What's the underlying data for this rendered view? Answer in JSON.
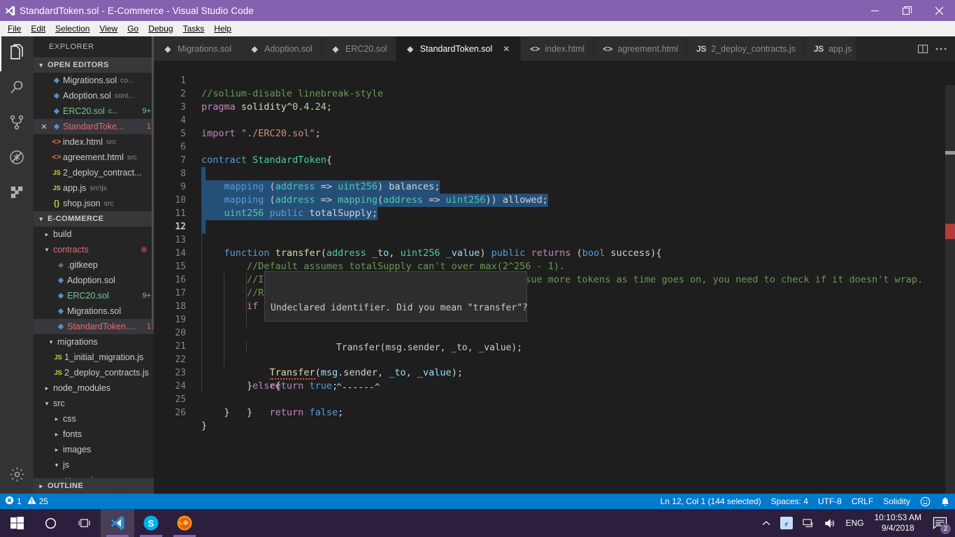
{
  "window": {
    "title": "StandardToken.sol - E-Commerce - Visual Studio Code",
    "icon": "vscode-logo-icon",
    "minimize": "minimize-icon",
    "maximize": "restore-icon",
    "close": "close-icon",
    "accent_color": "#8661b0"
  },
  "menu": {
    "items": [
      {
        "label": "File"
      },
      {
        "label": "Edit"
      },
      {
        "label": "Selection"
      },
      {
        "label": "View"
      },
      {
        "label": "Go"
      },
      {
        "label": "Debug"
      },
      {
        "label": "Tasks"
      },
      {
        "label": "Help"
      }
    ]
  },
  "activity_bar": {
    "items": [
      {
        "name": "explorer",
        "icon": "files-icon",
        "active": true
      },
      {
        "name": "search",
        "icon": "search-icon",
        "active": false
      },
      {
        "name": "source-control",
        "icon": "source-control-icon",
        "active": false
      },
      {
        "name": "debug",
        "icon": "debug-icon",
        "active": false
      },
      {
        "name": "extensions",
        "icon": "extensions-icon",
        "active": false
      }
    ],
    "bottom": [
      {
        "name": "manage",
        "icon": "gear-icon"
      }
    ]
  },
  "sidebar": {
    "title": "EXPLORER",
    "open_editors": {
      "label": "OPEN EDITORS",
      "items": [
        {
          "name": "Migrations.sol",
          "desc": "co...",
          "icon": "solidity-icon",
          "state": "normal",
          "badge": ""
        },
        {
          "name": "Adoption.sol",
          "desc": "cont...",
          "icon": "solidity-icon",
          "state": "normal",
          "badge": ""
        },
        {
          "name": "ERC20.sol",
          "desc": "c...",
          "icon": "solidity-icon",
          "state": "modified",
          "badge": "9+"
        },
        {
          "name": "StandardToke...",
          "desc": "",
          "icon": "solidity-icon",
          "state": "error",
          "badge": "1",
          "selected": true,
          "close": "✕"
        },
        {
          "name": "index.html",
          "desc": "src",
          "icon": "html-icon",
          "state": "normal",
          "badge": ""
        },
        {
          "name": "agreement.html",
          "desc": "src",
          "icon": "html-icon",
          "state": "normal",
          "badge": ""
        },
        {
          "name": "2_deploy_contract...",
          "desc": "",
          "icon": "js-icon",
          "state": "normal",
          "badge": ""
        },
        {
          "name": "app.js",
          "desc": "src\\js",
          "icon": "js-icon",
          "state": "normal",
          "badge": ""
        },
        {
          "name": "shop.json",
          "desc": "src",
          "icon": "json-icon",
          "state": "normal",
          "badge": ""
        }
      ]
    },
    "project": {
      "label": "E-COMMERCE",
      "items": [
        {
          "name": "build",
          "kind": "folder",
          "expanded": false,
          "indent": 1,
          "state": "normal",
          "badge": ""
        },
        {
          "name": "contracts",
          "kind": "folder",
          "expanded": true,
          "indent": 1,
          "state": "error",
          "badge": "",
          "dot": true
        },
        {
          "name": ".gitkeep",
          "kind": "file",
          "icon": "gitkeep-icon",
          "indent": 2,
          "state": "normal",
          "badge": ""
        },
        {
          "name": "Adoption.sol",
          "kind": "file",
          "icon": "solidity-icon",
          "indent": 2,
          "state": "normal",
          "badge": ""
        },
        {
          "name": "ERC20.sol",
          "kind": "file",
          "icon": "solidity-icon",
          "indent": 2,
          "state": "modified",
          "badge": "9+"
        },
        {
          "name": "Migrations.sol",
          "kind": "file",
          "icon": "solidity-icon",
          "indent": 2,
          "state": "normal",
          "badge": ""
        },
        {
          "name": "StandardToken....",
          "kind": "file",
          "icon": "solidity-icon",
          "indent": 2,
          "state": "error",
          "badge": "1",
          "selected": true
        },
        {
          "name": "migrations",
          "kind": "folder",
          "expanded": true,
          "indent": 1,
          "state": "normal",
          "badge": ""
        },
        {
          "name": "1_initial_migration.js",
          "kind": "file",
          "icon": "js-icon",
          "indent": 2,
          "state": "normal",
          "badge": ""
        },
        {
          "name": "2_deploy_contracts.js",
          "kind": "file",
          "icon": "js-icon",
          "indent": 2,
          "state": "normal",
          "badge": ""
        },
        {
          "name": "node_modules",
          "kind": "folder",
          "expanded": false,
          "indent": 1,
          "state": "normal",
          "badge": ""
        },
        {
          "name": "src",
          "kind": "folder",
          "expanded": true,
          "indent": 1,
          "state": "normal",
          "badge": ""
        },
        {
          "name": "css",
          "kind": "folder",
          "expanded": false,
          "indent": 2,
          "state": "normal",
          "badge": ""
        },
        {
          "name": "fonts",
          "kind": "folder",
          "expanded": false,
          "indent": 2,
          "state": "normal",
          "badge": ""
        },
        {
          "name": "images",
          "kind": "folder",
          "expanded": false,
          "indent": 2,
          "state": "normal",
          "badge": ""
        },
        {
          "name": "js",
          "kind": "folder",
          "expanded": true,
          "indent": 2,
          "state": "normal",
          "badge": ""
        },
        {
          "name": "app.js",
          "kind": "file",
          "icon": "js-icon",
          "indent": 3,
          "state": "normal",
          "badge": ""
        }
      ]
    },
    "outline_label": "OUTLINE"
  },
  "tabs": {
    "items": [
      {
        "label": "Migrations.sol",
        "icon": "solidity-icon",
        "active": false
      },
      {
        "label": "Adoption.sol",
        "icon": "solidity-icon",
        "active": false
      },
      {
        "label": "ERC20.sol",
        "icon": "solidity-icon",
        "active": false
      },
      {
        "label": "StandardToken.sol",
        "icon": "solidity-icon",
        "active": true,
        "close": "✕"
      },
      {
        "label": "index.html",
        "icon": "html-icon",
        "active": false
      },
      {
        "label": "agreement.html",
        "icon": "html-icon",
        "active": false
      },
      {
        "label": "2_deploy_contracts.js",
        "icon": "js-icon",
        "active": false
      },
      {
        "label": "app.js",
        "icon": "js-icon",
        "active": false
      }
    ],
    "actions": [
      {
        "name": "split-editor-icon"
      },
      {
        "name": "more-actions-icon"
      }
    ]
  },
  "editor": {
    "lines": [
      {
        "n": "1",
        "text": "//solium-disable linebreak-style"
      },
      {
        "n": "2",
        "text": "pragma solidity^0.4.24;"
      },
      {
        "n": "3",
        "text": ""
      },
      {
        "n": "4",
        "text": "import \"./ERC20.sol\";"
      },
      {
        "n": "5",
        "text": ""
      },
      {
        "n": "6",
        "text": "contract StandardToken{"
      },
      {
        "n": "7",
        "text": ""
      },
      {
        "n": "8",
        "text": "    mapping (address => uint256) balances;"
      },
      {
        "n": "9",
        "text": "    mapping (address => mapping(address => uint256)) allowed;"
      },
      {
        "n": "10",
        "text": "    uint256 public totalSupply;"
      },
      {
        "n": "11",
        "text": ""
      },
      {
        "n": "12",
        "text": "    function transfer(address _to, uint256 _value) public returns (bool success){"
      },
      {
        "n": "13",
        "text": "        //Default assumes totalSupply can't over max(2^256 - 1)."
      },
      {
        "n": "14",
        "text": "        //If your token leaves out totalSupply and can issue more tokens as time goes on, you need to check if it doesn't wrap."
      },
      {
        "n": "15",
        "text": "        //Replace the if with this one instead."
      },
      {
        "n": "16",
        "text": "        if ("
      },
      {
        "n": "17",
        "text": ""
      },
      {
        "n": "18",
        "text": ""
      },
      {
        "n": "19",
        "text": "            Transfer(msg.sender, _to, _value);"
      },
      {
        "n": "20",
        "text": "            return true;"
      },
      {
        "n": "21",
        "text": "        }else{"
      },
      {
        "n": "22",
        "text": "            return false;"
      },
      {
        "n": "23",
        "text": "        }"
      },
      {
        "n": "24",
        "text": "    }"
      },
      {
        "n": "25",
        "text": ""
      },
      {
        "n": "26",
        "text": "}"
      }
    ],
    "current_line": "12",
    "hover_tooltip": {
      "line1": "Undeclared identifier. Did you mean \"transfer\"?",
      "line2": "            Transfer(msg.sender, _to, _value);",
      "line3": "            ^------^"
    },
    "error_marker_color": "#b43c3c",
    "selection_color": "#264f78"
  },
  "status_bar": {
    "errors_icon": "error-circle-icon",
    "errors": "1",
    "warnings_icon": "warning-triangle-icon",
    "warnings": "25",
    "cursor": "Ln 12, Col 1 (144 selected)",
    "indentation": "Spaces: 4",
    "encoding": "UTF-8",
    "eol": "CRLF",
    "language": "Solidity",
    "feedback_icon": "smiley-icon",
    "bell_icon": "bell-icon",
    "background": "#007acc"
  },
  "taskbar": {
    "start": "windows-start-icon",
    "cortana": "cortana-circle-icon",
    "taskview": "task-view-icon",
    "apps": [
      {
        "name": "vscode-taskbar-icon",
        "running": true,
        "focused": true
      },
      {
        "name": "skype-taskbar-icon",
        "running": true,
        "focused": false
      },
      {
        "name": "firefox-taskbar-icon",
        "running": true,
        "focused": false
      }
    ],
    "tray": {
      "show_hidden": "chevron-up-icon",
      "ie_icon": "internet-explorer-icon",
      "network_icon": "network-icon",
      "volume_icon": "volume-icon",
      "language": "ENG"
    },
    "clock": {
      "time": "10:10:53 AM",
      "date": "9/4/2018"
    },
    "notifications": {
      "icon": "action-center-icon",
      "count": "2"
    }
  }
}
